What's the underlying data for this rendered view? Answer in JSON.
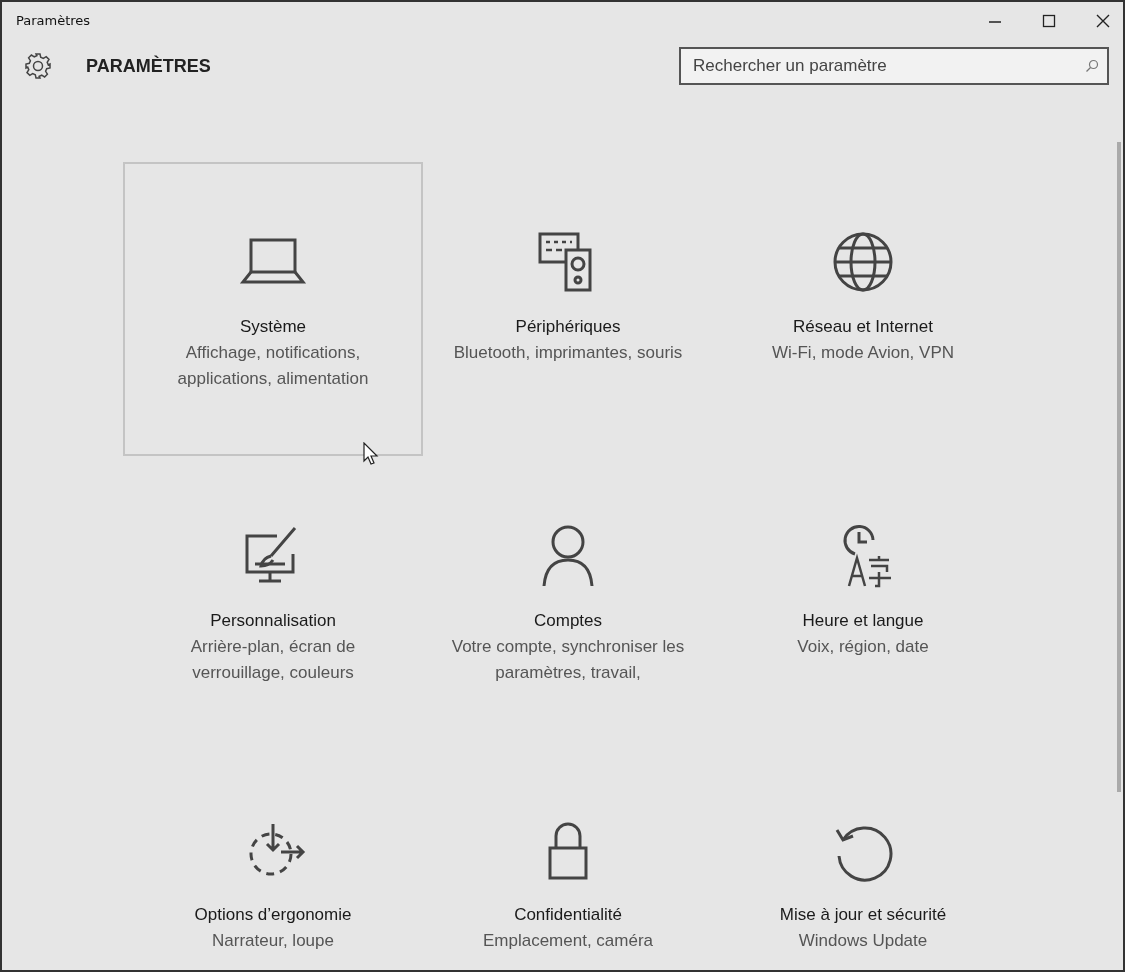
{
  "window": {
    "title": "Paramètres"
  },
  "header": {
    "title": "PARAMÈTRES"
  },
  "search": {
    "placeholder": "Rechercher un paramètre"
  },
  "categories": [
    {
      "kind": "system",
      "title": "Système",
      "description": "Affichage, notifications, applications, alimentation",
      "selected": true
    },
    {
      "kind": "devices",
      "title": "Périphériques",
      "description": "Bluetooth, imprimantes, souris",
      "selected": false
    },
    {
      "kind": "network",
      "title": "Réseau et Internet",
      "description": "Wi-Fi, mode Avion, VPN",
      "selected": false
    },
    {
      "kind": "personalization",
      "title": "Personnalisation",
      "description": "Arrière-plan, écran de verrouillage, couleurs",
      "selected": false
    },
    {
      "kind": "accounts",
      "title": "Comptes",
      "description": "Votre compte, synchroniser les paramètres, travail,",
      "selected": false
    },
    {
      "kind": "time",
      "title": "Heure et langue",
      "description": "Voix, région, date",
      "selected": false
    },
    {
      "kind": "access",
      "title": "Options d’ergonomie",
      "description": "Narrateur, loupe",
      "selected": false
    },
    {
      "kind": "privacy",
      "title": "Confidentialité",
      "description": "Emplacement, caméra",
      "selected": false
    },
    {
      "kind": "update",
      "title": "Mise à jour et sécurité",
      "description": "Windows Update",
      "selected": false
    }
  ]
}
